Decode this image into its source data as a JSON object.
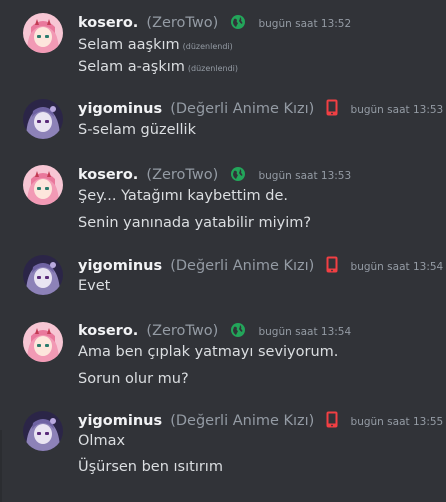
{
  "channel": {
    "messages": [
      {
        "user": "kosero.",
        "pronoun": "(ZeroTwo)",
        "status_icon": "globe-icon",
        "timestamp": "bugün saat 13:52",
        "lines": [
          {
            "text": "Selam aaşkım",
            "edited": "(düzenlendi)"
          },
          {
            "text": "Selam a-aşkım",
            "edited": "(düzenlendi)"
          }
        ]
      },
      {
        "user": "yigominus",
        "pronoun": "(Değerli Anime Kızı)",
        "status_icon": "mobile-phone-icon",
        "timestamp": "bugün saat 13:53",
        "lines": [
          {
            "text": "S-selam güzellik"
          }
        ]
      },
      {
        "user": "kosero.",
        "pronoun": "(ZeroTwo)",
        "status_icon": "globe-icon",
        "timestamp": "bugün saat 13:53",
        "lines": [
          {
            "text": "Şey... Yatağımı kaybettim de."
          },
          {
            "text": "Senin yanınada yatabilir miyim?"
          }
        ]
      },
      {
        "user": "yigominus",
        "pronoun": "(Değerli Anime Kızı)",
        "status_icon": "mobile-phone-icon",
        "timestamp": "bugün saat 13:54",
        "lines": [
          {
            "text": "Evet"
          }
        ]
      },
      {
        "user": "kosero.",
        "pronoun": "(ZeroTwo)",
        "status_icon": "globe-icon",
        "timestamp": "bugün saat 13:54",
        "lines": [
          {
            "text": "Ama ben çıplak yatmayı seviyorum."
          },
          {
            "text": "Sorun olur mu?"
          }
        ]
      },
      {
        "user": "yigominus",
        "pronoun": "(Değerli Anime Kızı)",
        "status_icon": "mobile-phone-icon",
        "timestamp": "bugün saat 13:55",
        "lines": [
          {
            "text": "Olmax"
          },
          {
            "text": "Üşürsen ben ısıtırım"
          }
        ]
      }
    ]
  },
  "colors": {
    "background": "#313338",
    "username": "#f2f3f5",
    "text": "#dbdee1",
    "muted": "#949ba4",
    "globe": "#23a55a",
    "mobile": "#f23f43"
  }
}
